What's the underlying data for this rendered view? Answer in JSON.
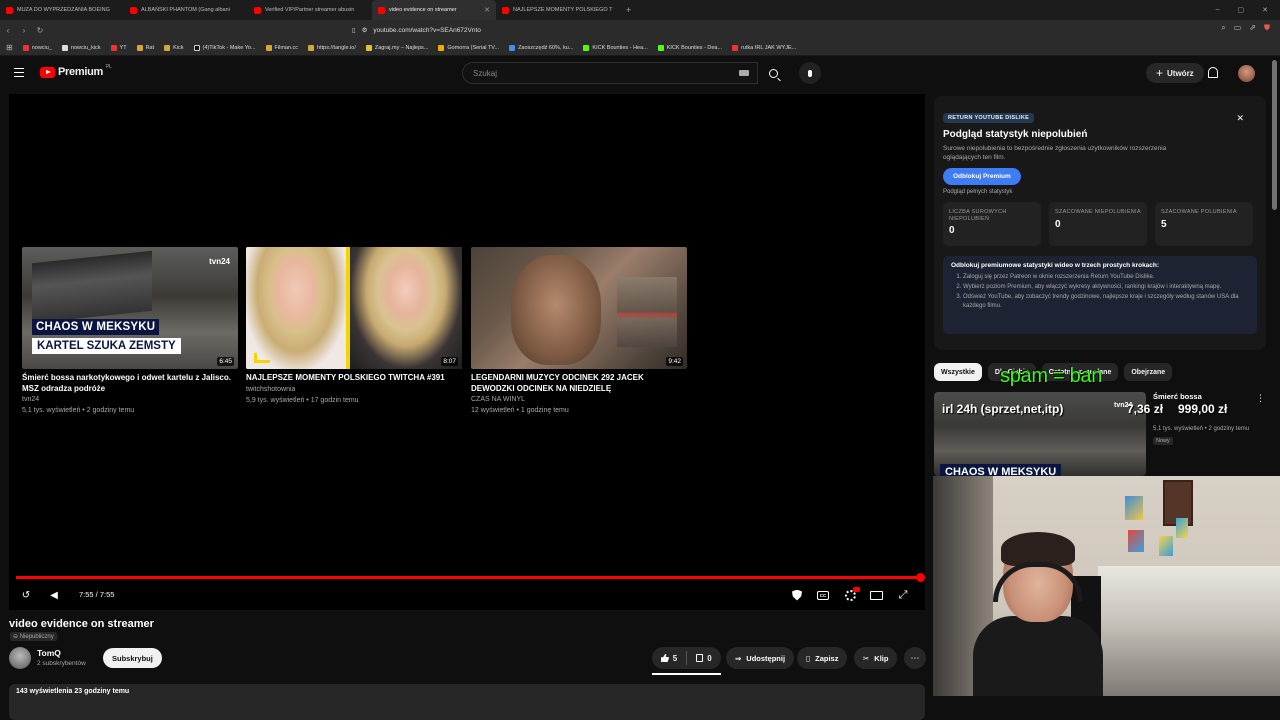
{
  "browser": {
    "tabs": [
      {
        "label": "MUZA DO WYPRZEDZANIA BOEING",
        "active": false
      },
      {
        "label": "ALBAŃSKI PHANTOM (Gang albani",
        "active": false
      },
      {
        "label": "Verified VIP/Partner streamer abusin",
        "active": false
      },
      {
        "label": "video evidence on streamer",
        "active": true
      },
      {
        "label": "NAJLEPSZE MOMENTY POLSKIEGO T",
        "active": false
      }
    ],
    "url": "youtube.com/watch?v=SEAn672Vnto",
    "bookmarks": [
      "nowciu_",
      "nowciu_kick",
      "YT",
      "Rat",
      "Kick",
      "(4)TikTok - Make Yo...",
      "Filman.cc",
      "https://tangle.io/",
      "Zagraj.my – Najleps...",
      "Gomorra (Serial TV...",
      "Zaoszczędź 60%, ku...",
      "KICK Bounties - Hea...",
      "KICK Bounties - Dea...",
      "rutka IRL JAK WYJE..."
    ]
  },
  "header": {
    "logo_text": "Premium",
    "logo_region": "PL",
    "search_placeholder": "Szukaj",
    "create_label": "Utwórz"
  },
  "player": {
    "endcards": [
      {
        "title": "Śmierć bossa narkotykowego i odwet kartelu z Jalisco. MSZ odradza podróże",
        "channel": "tvn24",
        "meta": "5,1 tys. wyświetleń • 2 godziny temu",
        "duration": "6:45",
        "caption1": "CHAOS W MEKSYKU",
        "caption2": "KARTEL SZUKA ZEMSTY",
        "brand": "tvn24"
      },
      {
        "title": "NAJLEPSZE MOMENTY POLSKIEGO TWITCHA #391",
        "channel": "twitchshotownia",
        "meta": "5,9 tys. wyświetleń • 17 godzin temu",
        "duration": "8:07"
      },
      {
        "title": "LEGENDARNI MUZYCY ODCINEK 292 JACEK DEWODZKI ODCINEK NA NIEDZIELĘ",
        "channel": "CZAS NA WINYL",
        "meta": "12 wyświetleń • 1 godzinę temu",
        "duration": "9:42"
      }
    ],
    "progress": 1.0,
    "time": "7:55 / 7:55"
  },
  "video": {
    "title": "video evidence on streamer",
    "visibility": "Niepubliczny",
    "channel_name": "TomQ",
    "channel_subs": "2 subskrybentów",
    "subscribe_label": "Subskrybuj",
    "likes": "5",
    "dislikes": "0",
    "share_label": "Udostępnij",
    "save_label": "Zapisz",
    "clip_label": "Klip",
    "views_date": "143 wyświetlenia  23 godziny temu"
  },
  "ryd": {
    "badge": "RETURN YOUTUBE DISLIKE",
    "title": "Podgląd statystyk niepolubień",
    "description": "Surowe niepolubienia to bezpośrednie zgłoszenia użytkowników rozszerzenia oglądających ten film.",
    "unlock_button": "Odblokuj Premium",
    "full_stats": "Podgląd pełnych statystyk",
    "stats": [
      {
        "label": "LICZBA SUROWYCH NIEPOLUBIEŃ",
        "value": "0"
      },
      {
        "label": "SZACOWANE NIEPOLUBIENIA",
        "value": "0"
      },
      {
        "label": "SZACOWANE POLUBIENIA",
        "value": "5"
      }
    ],
    "promo_title": "Odblokuj premiumowe statystyki wideo w trzech prostych krokach:",
    "promo_steps": [
      "Zaloguj się przez Patreon w oknie rozszerzenia Return YouTube Dislike.",
      "Wybierz poziom Premium, aby włączyć wykresy aktywności, rankingi krajów i interaktywną mapę.",
      "Odśwież YouTube, aby zobaczyć trendy godzinowe, najlepsze kraje i szczegóły według stanów USA dla każdego filmu."
    ]
  },
  "chips": [
    "Wszystkie",
    "Dla Ciebie",
    "Ostatnio przesłane",
    "Obejrzane"
  ],
  "recommendation": {
    "title": "Śmierć bossa",
    "meta": "5,1 tys. wyświetleń • 2 godziny temu",
    "badge": "Nowy",
    "caption": "CHAOS W MEKSYKU",
    "brand": "tvn24"
  },
  "overlay": {
    "spam": "spam = ban",
    "irl": "irl 24h (sprzet,net,itp)",
    "amount1": "7,36 zł",
    "amount2": "999,00 zł"
  },
  "colors": {
    "accent_red": "#ff0000",
    "ryd_button": "#3d7cf2",
    "overlay_green": "#39ff14"
  }
}
